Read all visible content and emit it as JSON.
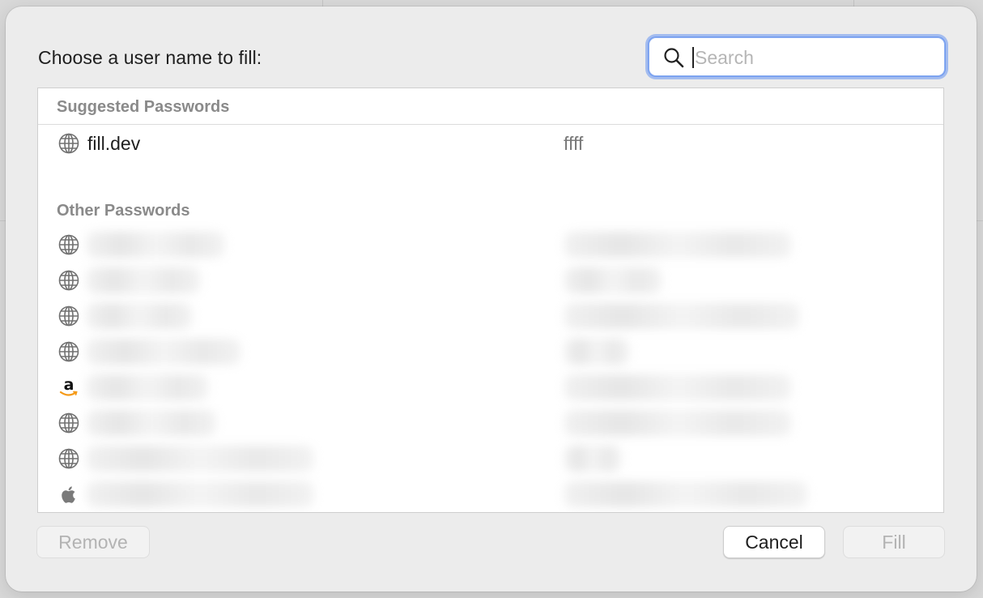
{
  "dialog": {
    "prompt": "Choose a user name to fill:"
  },
  "search": {
    "placeholder": "Search",
    "value": "",
    "icon": "magnifier-icon"
  },
  "suggested": {
    "header": "Suggested Passwords",
    "items": [
      {
        "site": "fill.dev",
        "user": "ffff",
        "icon": "globe-icon"
      }
    ]
  },
  "other": {
    "header": "Other Passwords",
    "items": [
      {
        "icon": "globe-icon",
        "redacted": true
      },
      {
        "icon": "globe-icon",
        "redacted": true
      },
      {
        "icon": "globe-icon",
        "redacted": true
      },
      {
        "icon": "globe-icon",
        "redacted": true
      },
      {
        "icon": "amazon-icon",
        "redacted": true
      },
      {
        "icon": "globe-icon",
        "redacted": true
      },
      {
        "icon": "globe-icon",
        "redacted": true
      },
      {
        "icon": "apple-icon",
        "redacted": true
      }
    ]
  },
  "buttons": {
    "remove": "Remove",
    "cancel": "Cancel",
    "fill": "Fill"
  },
  "colors": {
    "focus_ring": "#6896f2",
    "amazon_smile": "#f59a17"
  }
}
